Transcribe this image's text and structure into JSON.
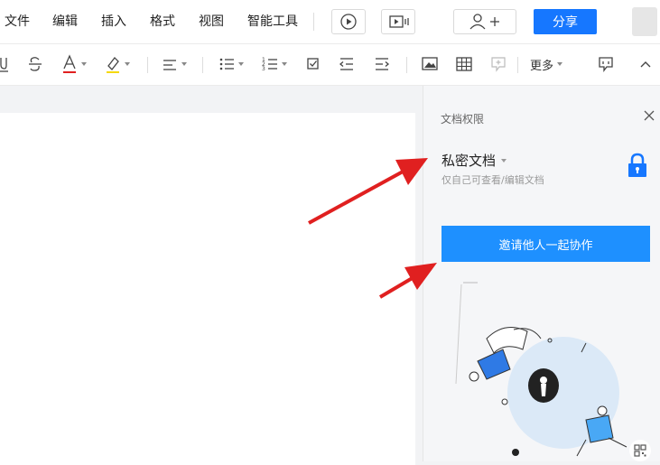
{
  "menubar": {
    "items": [
      "文件",
      "编辑",
      "插入",
      "格式",
      "视图",
      "智能工具"
    ],
    "share_label": "分享"
  },
  "toolbar": {
    "more_label": "更多"
  },
  "panel": {
    "title": "文档权限",
    "permission": "私密文档",
    "permission_desc": "仅自己可查看/编辑文档",
    "invite_label": "邀请他人一起协作"
  },
  "colors": {
    "accent": "#1677ff",
    "invite_button": "#1e90ff",
    "annotation_arrow": "#e02020"
  }
}
